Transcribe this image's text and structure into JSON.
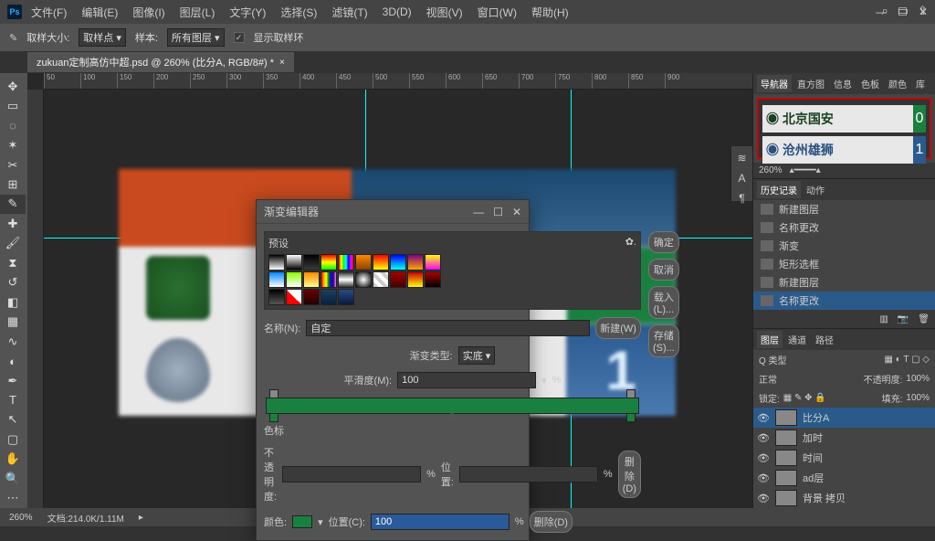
{
  "app": {
    "logo": "Ps"
  },
  "menu": [
    "文件(F)",
    "编辑(E)",
    "图像(I)",
    "图层(L)",
    "文字(Y)",
    "选择(S)",
    "滤镜(T)",
    "3D(D)",
    "视图(V)",
    "窗口(W)",
    "帮助(H)"
  ],
  "options": {
    "sample_size_label": "取样大小:",
    "sample_size_value": "取样点",
    "sample_label": "样本:",
    "sample_value": "所有图层",
    "show_ring": "显示取样环",
    "checked": "✓"
  },
  "doc": {
    "tab": "zukuan定制高仿中超.psd @ 260% (比分A, RGB/8#) *",
    "close": "×"
  },
  "ruler": [
    "50",
    "100",
    "150",
    "200",
    "250",
    "300",
    "350",
    "400",
    "450",
    "500",
    "550",
    "600",
    "650",
    "700",
    "750",
    "800",
    "850",
    "900"
  ],
  "preview": {
    "team1": "北京国安",
    "score1": "0",
    "team2": "沧州雄狮",
    "score2": "1"
  },
  "nav_zoom": "260%",
  "panels": {
    "top_tabs": [
      "导航器",
      "直方图",
      "信息",
      "色板",
      "颜色",
      "库"
    ],
    "history_tab": "历史记录",
    "actions_tab": "动作",
    "history": [
      "新建图层",
      "名称更改",
      "渐变",
      "矩形选框",
      "新建图层",
      "名称更改"
    ],
    "layers_tab": "图层",
    "channels_tab": "通道",
    "paths_tab": "路径",
    "kind": "Q 类型",
    "blend": "正常",
    "opacity_label": "不透明度:",
    "opacity": "100%",
    "lock": "锁定:",
    "fill_label": "填充:",
    "fill": "100%",
    "layers": [
      "比分A",
      "加时",
      "时间",
      "ad层",
      "背景 拷贝"
    ]
  },
  "status": {
    "zoom": "260%",
    "docinfo": "文档:214.0K/1.11M"
  },
  "dialog": {
    "title": "渐变编辑器",
    "presets": "预设",
    "ok": "确定",
    "cancel": "取消",
    "load": "载入(L)...",
    "save": "存储(S)...",
    "name_label": "名称(N):",
    "name_value": "自定",
    "new": "新建(W)",
    "grad_type_label": "渐变类型:",
    "grad_type": "实底",
    "smoothness_label": "平滑度(M):",
    "smoothness": "100",
    "pct": "%",
    "stops": "色标",
    "opacity_label": "不透明度:",
    "pos_label": "位置:",
    "delete1": "删除(D)",
    "color_label": "颜色:",
    "pos2_label": "位置(C):",
    "pos2": "100",
    "delete2": "删除(D)"
  },
  "swatches": [
    "linear-gradient(#000,#fff)",
    "linear-gradient(#fff,#000)",
    "linear-gradient(#000,transparent)",
    "linear-gradient(#f00,#ff0,#0f0)",
    "linear-gradient(90deg,#f00,#ff0,#0f0,#0ff,#00f,#f0f,#f00)",
    "linear-gradient(#f80,#840)",
    "linear-gradient(#f00,#ff0)",
    "linear-gradient(#00f,#0ff)",
    "linear-gradient(#800080,#ffa500)",
    "linear-gradient(#ff0,#f0f)",
    "linear-gradient(#08f,#fff)",
    "linear-gradient(#8f0,#fff)",
    "linear-gradient(#f80,#ff8)",
    "linear-gradient(90deg,red,orange,yellow,green,blue,indigo,violet)",
    "linear-gradient(#333,#fff,#333)",
    "radial-gradient(#fff,#000)",
    "repeating-linear-gradient(45deg,#ccc 0 4px,#fff 4px 8px)",
    "linear-gradient(#a00,#400)",
    "linear-gradient(#c00,#ff0)",
    "linear-gradient(#a00,#000)",
    "linear-gradient(#000,#555)",
    "linear-gradient(45deg,#f00 50%,#fff 50%)",
    "linear-gradient(#600,#200)",
    "linear-gradient(#1a4060,#0a2040)",
    "linear-gradient(#2a4a80,#0a1a40)"
  ]
}
